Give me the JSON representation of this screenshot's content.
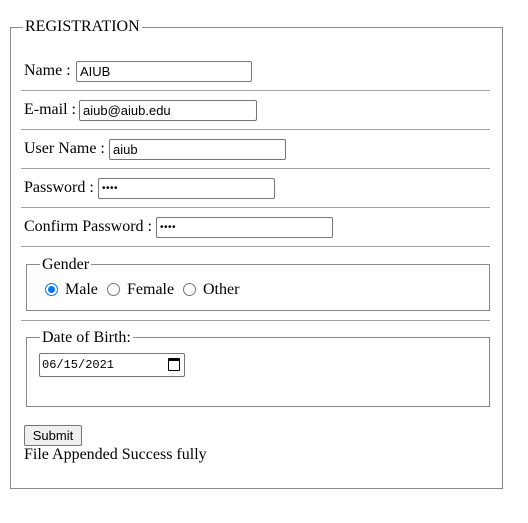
{
  "form": {
    "legend": "REGISTRATION",
    "name": {
      "label": "Name :",
      "value": "AIUB"
    },
    "email": {
      "label": "E-mail :",
      "value": "aiub@aiub.edu"
    },
    "username": {
      "label": "User Name :",
      "value": "aiub"
    },
    "password": {
      "label": "Password :",
      "value": "••••"
    },
    "confirm_password": {
      "label": "Confirm Password :",
      "value": "••••"
    },
    "gender": {
      "legend": "Gender",
      "options": [
        "Male",
        "Female",
        "Other"
      ],
      "selected": "Male"
    },
    "dob": {
      "legend": "Date of Birth:",
      "value": "06/15/2021",
      "icon": "calendar-icon"
    },
    "submit_label": "Submit",
    "status_message": "File Appended Success fully"
  },
  "colors": {
    "border": "#8a8a8a",
    "accent": "#0075ff",
    "button_bg": "#efefef"
  }
}
